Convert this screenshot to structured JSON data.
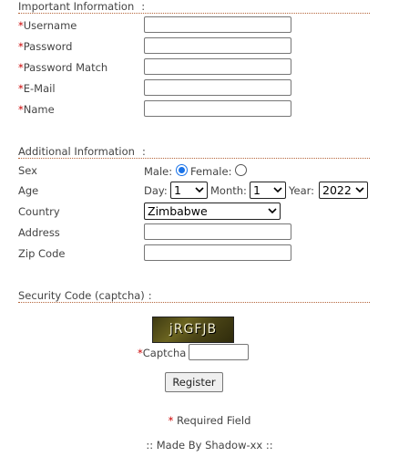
{
  "important_section": {
    "title": "Important Information",
    "colon": ":",
    "fields": [
      {
        "required_mark": "*",
        "label": "Username",
        "value": ""
      },
      {
        "required_mark": "*",
        "label": "Password",
        "value": ""
      },
      {
        "required_mark": "*",
        "label": "Password Match",
        "value": ""
      },
      {
        "required_mark": "*",
        "label": "E-Mail",
        "value": ""
      },
      {
        "required_mark": "*",
        "label": "Name",
        "value": ""
      }
    ]
  },
  "additional_section": {
    "title": "Additional Information",
    "colon": ":",
    "sex": {
      "label": "Sex",
      "male_label": "Male:",
      "female_label": "Female:",
      "selected": "Male"
    },
    "age": {
      "label": "Age",
      "day_label": "Day:",
      "day_value": "1",
      "month_label": "Month:",
      "month_value": "1",
      "year_label": "Year:",
      "year_value": "2022"
    },
    "country": {
      "label": "Country",
      "value": "Zimbabwe"
    },
    "address": {
      "label": "Address",
      "value": ""
    },
    "zip": {
      "label": "Zip Code",
      "value": ""
    }
  },
  "security_section": {
    "title": "Security Code (captcha)",
    "colon": ":",
    "captcha_image_text": "jRGFJB",
    "captcha_required_mark": "*",
    "captcha_label": "Captcha",
    "captcha_value": ""
  },
  "register_button_label": "Register",
  "required_note": {
    "mark": "*",
    "text": " Required Field"
  },
  "footer_text": ":: Made By Shadow-xx ::",
  "colors": {
    "required": "#cc0000",
    "section_rule": "#b5653b",
    "radio_selected": "#1a73e8"
  }
}
